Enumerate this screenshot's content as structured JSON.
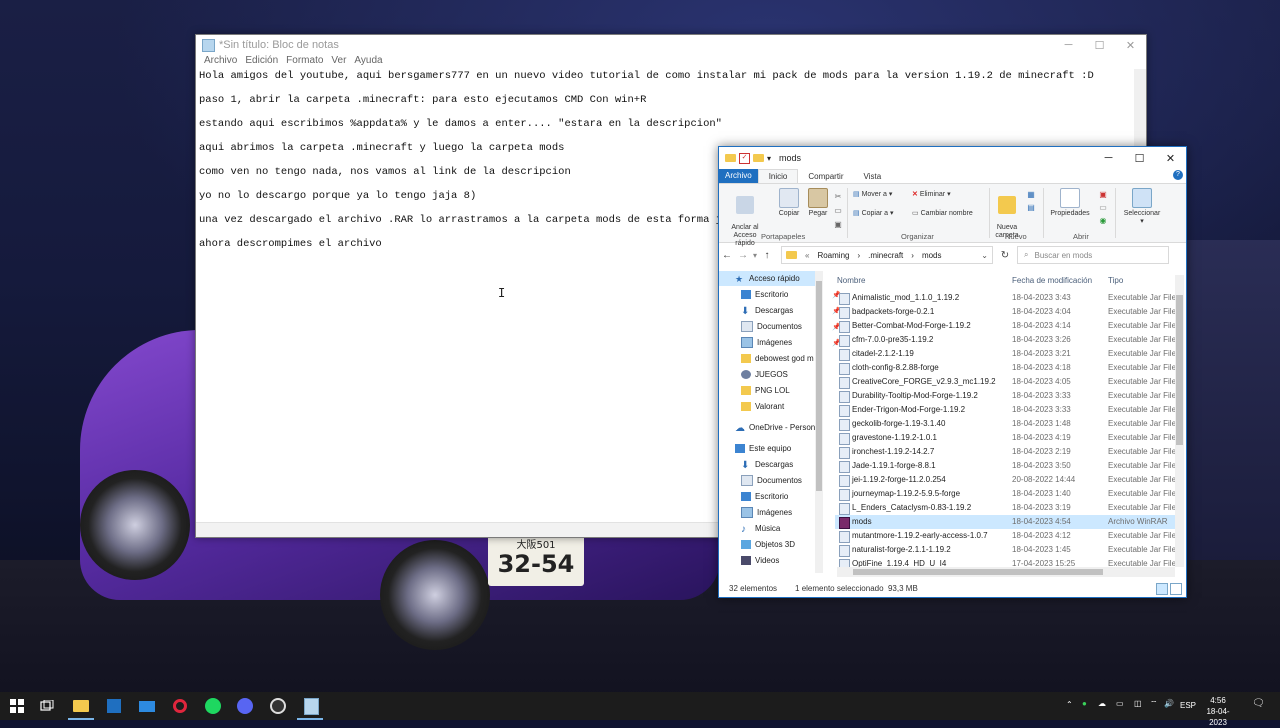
{
  "wallpaper": {
    "plate_top": "大阪501",
    "plate_num": "32-54"
  },
  "notepad": {
    "title": "*Sin título: Bloc de notas",
    "menu": [
      "Archivo",
      "Edición",
      "Formato",
      "Ver",
      "Ayuda"
    ],
    "lines": [
      "Hola amigos del youtube, aqui bersgamers777 en un nuevo video tutorial de como instalar mi pack de mods para la version 1.19.2 de minecraft :D",
      "paso 1, abrir la carpeta .minecraft: para esto ejecutamos CMD Con win+R",
      "estando aqui escribimos %appdata% y le damos a enter.... \"estara en la descripcion\"",
      "aqui abrimos la carpeta .minecraft y luego la carpeta mods",
      "como ven no tengo nada, nos vamos al link de la descripcion",
      "yo no lo descargo porque ya lo tengo jaja 8)",
      "una vez descargado el archivo .RAR lo arrastramos a la carpeta mods de esta forma jaja",
      "ahora descrompimes el archivo"
    ]
  },
  "explorer": {
    "title": "mods",
    "tabs": {
      "file": "Archivo",
      "home": "Inicio",
      "share": "Compartir",
      "view": "Vista"
    },
    "ribbon": {
      "pin": "Anclar al\nAcceso rápido",
      "copy": "Copiar",
      "paste": "Pegar",
      "move": "Mover a",
      "copy_to": "Copiar a",
      "delete": "Eliminar",
      "rename": "Cambiar nombre",
      "new_folder": "Nueva\ncarpeta",
      "properties": "Propiedades",
      "select": "Seleccionar",
      "g_clipboard": "Portapapeles",
      "g_organize": "Organizar",
      "g_new": "Nuevo",
      "g_open": "Abrir"
    },
    "address": {
      "prefix": "«",
      "parts": [
        "Roaming",
        ".minecraft",
        "mods"
      ]
    },
    "search_placeholder": "Buscar en mods",
    "nav": [
      {
        "label": "Acceso rápido",
        "icon": "star-icon"
      },
      {
        "label": "Escritorio",
        "icon": "desktop-icon",
        "pin": true
      },
      {
        "label": "Descargas",
        "icon": "download-icon",
        "pin": true
      },
      {
        "label": "Documentos",
        "icon": "documents-icon",
        "pin": true
      },
      {
        "label": "Imágenes",
        "icon": "pictures-icon",
        "pin": true
      },
      {
        "label": "debowest god m",
        "icon": "folder-icon"
      },
      {
        "label": "JUEGOS",
        "icon": "games-icon"
      },
      {
        "label": "PNG LOL",
        "icon": "folder-icon"
      },
      {
        "label": "Valorant",
        "icon": "folder-icon"
      },
      {
        "label": "OneDrive - Person",
        "icon": "onedrive-icon"
      },
      {
        "label": "Este equipo",
        "icon": "computer-icon"
      },
      {
        "label": "Descargas",
        "icon": "download-icon"
      },
      {
        "label": "Documentos",
        "icon": "documents-icon"
      },
      {
        "label": "Escritorio",
        "icon": "desktop-icon"
      },
      {
        "label": "Imágenes",
        "icon": "pictures-icon"
      },
      {
        "label": "Música",
        "icon": "music-icon"
      },
      {
        "label": "Objetos 3D",
        "icon": "3d-objects-icon"
      },
      {
        "label": "Videos",
        "icon": "videos-icon"
      }
    ],
    "columns": {
      "name": "Nombre",
      "date": "Fecha de modificación",
      "type": "Tipo"
    },
    "files": [
      {
        "name": "Animalistic_mod_1.1.0_1.19.2",
        "date": "18-04-2023 3:43",
        "type": "Executable Jar File"
      },
      {
        "name": "badpackets-forge-0.2.1",
        "date": "18-04-2023 4:04",
        "type": "Executable Jar File"
      },
      {
        "name": "Better-Combat-Mod-Forge-1.19.2",
        "date": "18-04-2023 4:14",
        "type": "Executable Jar File"
      },
      {
        "name": "cfm-7.0.0-pre35-1.19.2",
        "date": "18-04-2023 3:26",
        "type": "Executable Jar File"
      },
      {
        "name": "citadel-2.1.2-1.19",
        "date": "18-04-2023 3:21",
        "type": "Executable Jar File"
      },
      {
        "name": "cloth-config-8.2.88-forge",
        "date": "18-04-2023 4:18",
        "type": "Executable Jar File"
      },
      {
        "name": "CreativeCore_FORGE_v2.9.3_mc1.19.2",
        "date": "18-04-2023 4:05",
        "type": "Executable Jar File"
      },
      {
        "name": "Durability-Tooltip-Mod-Forge-1.19.2",
        "date": "18-04-2023 3:33",
        "type": "Executable Jar File"
      },
      {
        "name": "Ender-Trigon-Mod-Forge-1.19.2",
        "date": "18-04-2023 3:33",
        "type": "Executable Jar File"
      },
      {
        "name": "geckolib-forge-1.19-3.1.40",
        "date": "18-04-2023 1:48",
        "type": "Executable Jar File"
      },
      {
        "name": "gravestone-1.19.2-1.0.1",
        "date": "18-04-2023 4:19",
        "type": "Executable Jar File"
      },
      {
        "name": "ironchest-1.19.2-14.2.7",
        "date": "18-04-2023 2:19",
        "type": "Executable Jar File"
      },
      {
        "name": "Jade-1.19.1-forge-8.8.1",
        "date": "18-04-2023 3:50",
        "type": "Executable Jar File"
      },
      {
        "name": "jei-1.19.2-forge-11.2.0.254",
        "date": "20-08-2022 14:44",
        "type": "Executable Jar File"
      },
      {
        "name": "journeymap-1.19.2-5.9.5-forge",
        "date": "18-04-2023 1:40",
        "type": "Executable Jar File"
      },
      {
        "name": "L_Enders_Cataclysm-0.83-1.19.2",
        "date": "18-04-2023 3:19",
        "type": "Executable Jar File"
      },
      {
        "name": "mods",
        "date": "18-04-2023 4:54",
        "type": "Archivo WinRAR",
        "selected": true
      },
      {
        "name": "mutantmore-1.19.2-early-access-1.0.7",
        "date": "18-04-2023 4:12",
        "type": "Executable Jar File"
      },
      {
        "name": "naturalist-forge-2.1.1-1.19.2",
        "date": "18-04-2023 1:45",
        "type": "Executable Jar File"
      },
      {
        "name": "OptiFine_1.19.4_HD_U_I4",
        "date": "17-04-2023 15:25",
        "type": "Executable Jar File"
      }
    ],
    "status": {
      "count": "32 elementos",
      "selection": "1 elemento seleccionado  93,3 MB"
    }
  },
  "taskbar": {
    "language": "ESP",
    "time": "4:56",
    "date": "18-04-2023"
  },
  "colors": {
    "accent": "#1f6fc0",
    "selection": "#cce8ff",
    "taskbar": "#1c1c1c"
  }
}
